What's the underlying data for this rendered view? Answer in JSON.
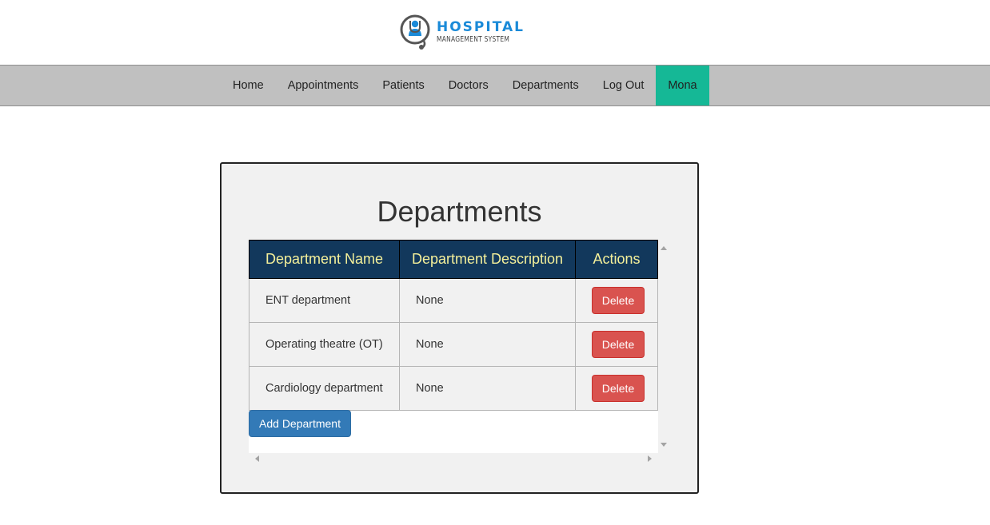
{
  "brand": {
    "title": "HOSPITAL",
    "subtitle": "MANAGEMENT SYSTEM",
    "logo_icon": "stethoscope-doctor-icon"
  },
  "nav": {
    "items": [
      {
        "label": "Home"
      },
      {
        "label": "Appointments"
      },
      {
        "label": "Patients"
      },
      {
        "label": "Doctors"
      },
      {
        "label": "Departments"
      },
      {
        "label": "Log Out"
      }
    ],
    "user": "Mona"
  },
  "page": {
    "title": "Departments"
  },
  "table": {
    "headers": [
      "Department Name",
      "Department Description",
      "Actions"
    ],
    "rows": [
      {
        "name": "ENT department",
        "description": "None",
        "action": "Delete"
      },
      {
        "name": "Operating theatre (OT)",
        "description": "None",
        "action": "Delete"
      },
      {
        "name": "Cardiology department",
        "description": "None",
        "action": "Delete"
      }
    ]
  },
  "add_button": "Add Department",
  "colors": {
    "nav_bg": "#c0c0c0",
    "user_bg": "#15b896",
    "table_header_bg": "#12385c",
    "table_header_text": "#f5f09a",
    "delete_btn": "#d9534f",
    "add_btn": "#337ab7",
    "brand_blue": "#1a8ad8"
  }
}
